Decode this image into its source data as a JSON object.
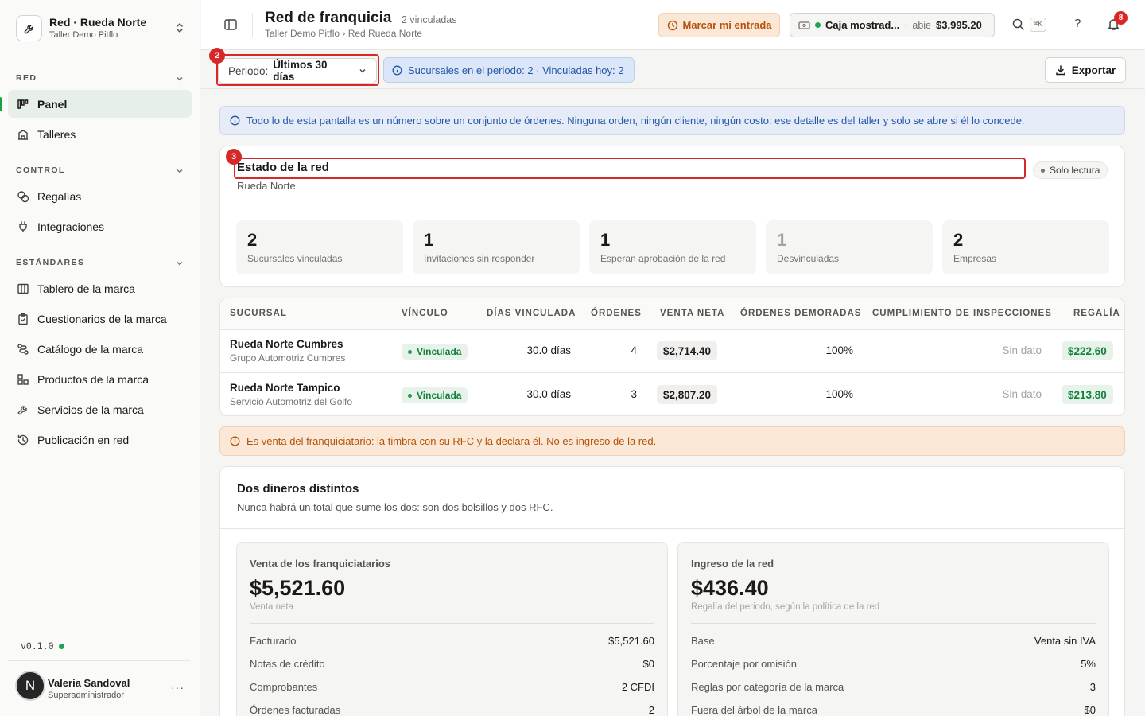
{
  "org": {
    "name": "Red · Rueda Norte",
    "subtitle": "Taller Demo Pitflo"
  },
  "sidebar": {
    "sections": [
      {
        "label": "RED",
        "items": [
          {
            "label": "Panel",
            "icon": "chart-icon",
            "active": true
          },
          {
            "label": "Talleres",
            "icon": "building-icon"
          }
        ]
      },
      {
        "label": "CONTROL",
        "items": [
          {
            "label": "Regalías",
            "icon": "coins-icon"
          },
          {
            "label": "Integraciones",
            "icon": "plug-icon"
          }
        ]
      },
      {
        "label": "ESTÁNDARES",
        "items": [
          {
            "label": "Tablero de la marca",
            "icon": "columns-icon"
          },
          {
            "label": "Cuestionarios de la marca",
            "icon": "clipboard-icon"
          },
          {
            "label": "Catálogo de la marca",
            "icon": "route-icon"
          },
          {
            "label": "Productos de la marca",
            "icon": "boxes-icon"
          },
          {
            "label": "Servicios de la marca",
            "icon": "wrench-icon"
          },
          {
            "label": "Publicación en red",
            "icon": "history-icon"
          }
        ]
      }
    ],
    "version": "v0.1.0",
    "user": {
      "initial": "N",
      "name": "Valeria Sandoval",
      "role": "Superadministrador",
      "more": "···"
    }
  },
  "header": {
    "title": "Red de franquicia",
    "count": "2 vinculadas",
    "breadcrumb": "Taller Demo Pitflo › Red Rueda Norte",
    "entrada_label": "Marcar mi entrada",
    "caja": {
      "name": "Caja mostrad...",
      "sep": "·",
      "status": "abie",
      "amount": "$3,995.20"
    },
    "search_kbd": "⌘K",
    "help": "?",
    "notifications": "8"
  },
  "toolbar": {
    "periodo_label": "Periodo:",
    "periodo_value": "Últimos 30 días",
    "sucursales_info": "Sucursales en el periodo: 2 · Vinculadas hoy: 2",
    "export_label": "Exportar",
    "marker_periodo": "2"
  },
  "info_banner": "Todo lo de esta pantalla es un número sobre un conjunto de órdenes. Ninguna orden, ningún cliente, ningún costo: ese detalle es del taller y solo se abre si él lo concede.",
  "estado": {
    "marker": "3",
    "title": "Estado de la red",
    "subtitle": "Rueda Norte",
    "badge": "Solo lectura",
    "stats": [
      {
        "n": "2",
        "label": "Sucursales vinculadas"
      },
      {
        "n": "1",
        "label": "Invitaciones sin responder"
      },
      {
        "n": "1",
        "label": "Esperan aprobación de la red"
      },
      {
        "n": "1",
        "label": "Desvinculadas"
      },
      {
        "n": "2",
        "label": "Empresas"
      }
    ]
  },
  "table": {
    "headers": [
      "SUCURSAL",
      "VÍNCULO",
      "DÍAS VINCULADA",
      "ÓRDENES",
      "VENTA NETA",
      "ÓRDENES DEMORADAS",
      "CUMPLIMIENTO DE INSPECCIONES",
      "REGALÍA"
    ],
    "rows": [
      {
        "name": "Rueda Norte Cumbres",
        "company": "Grupo Automotriz Cumbres",
        "vinculo": "Vinculada",
        "dias": "30.0 días",
        "ordenes": "4",
        "venta": "$2,714.40",
        "demoradas": "100%",
        "cumplimiento": "Sin dato",
        "regalia": "$222.60"
      },
      {
        "name": "Rueda Norte Tampico",
        "company": "Servicio Automotriz del Golfo",
        "vinculo": "Vinculada",
        "dias": "30.0 días",
        "ordenes": "3",
        "venta": "$2,807.20",
        "demoradas": "100%",
        "cumplimiento": "Sin dato",
        "regalia": "$213.80"
      }
    ]
  },
  "warn_banner": "Es venta del franquiciatario: la timbra con su RFC y la declara él. No es ingreso de la red.",
  "dineros": {
    "title": "Dos dineros distintos",
    "subtitle": "Nunca habrá un total que sume los dos: son dos bolsillos y dos RFC.",
    "venta": {
      "title": "Venta de los franquiciatarios",
      "amount": "$5,521.60",
      "sub": "Venta neta",
      "rows": [
        {
          "k": "Facturado",
          "v": "$5,521.60"
        },
        {
          "k": "Notas de crédito",
          "v": "$0"
        },
        {
          "k": "Comprobantes",
          "v": "2 CFDI"
        },
        {
          "k": "Órdenes facturadas",
          "v": "2"
        }
      ]
    },
    "ingreso": {
      "title": "Ingreso de la red",
      "amount": "$436.40",
      "sub": "Regalía del periodo, según la política de la red",
      "rows": [
        {
          "k": "Base",
          "v": "Venta sin IVA"
        },
        {
          "k": "Porcentaje por omisión",
          "v": "5%"
        },
        {
          "k": "Reglas por categoría de la marca",
          "v": "3"
        },
        {
          "k": "Fuera del árbol de la marca",
          "v": "$0"
        }
      ]
    }
  }
}
